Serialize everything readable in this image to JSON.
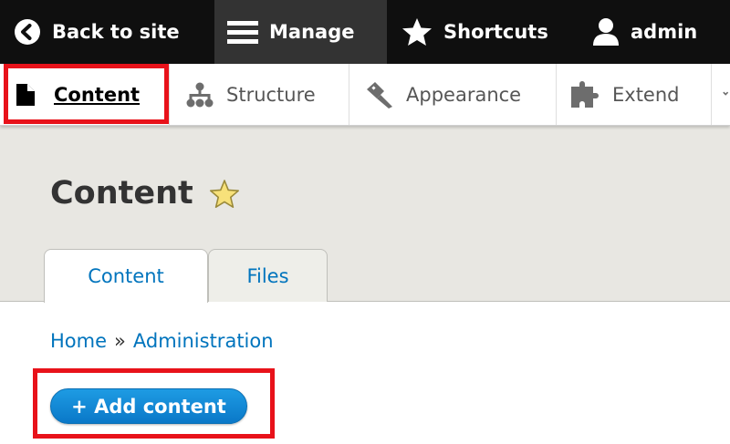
{
  "toolbar": {
    "back_label": "Back to site",
    "manage_label": "Manage",
    "shortcuts_label": "Shortcuts",
    "user_label": "admin"
  },
  "tray": {
    "items": [
      {
        "label": "Content",
        "icon": "document-icon",
        "active": true
      },
      {
        "label": "Structure",
        "icon": "sitemap-icon"
      },
      {
        "label": "Appearance",
        "icon": "paint-roller-icon"
      },
      {
        "label": "Extend",
        "icon": "puzzle-icon"
      }
    ]
  },
  "page": {
    "title": "Content",
    "tabs": [
      {
        "label": "Content",
        "active": true
      },
      {
        "label": "Files"
      }
    ]
  },
  "breadcrumb": {
    "home": "Home",
    "separator": "»",
    "administration": "Administration"
  },
  "actions": {
    "add_content": "+ Add content"
  },
  "colors": {
    "toolbar_bg": "#0f0f0f",
    "link": "#0074bd",
    "button": "#1e9be3",
    "highlight": "#e8121a"
  }
}
